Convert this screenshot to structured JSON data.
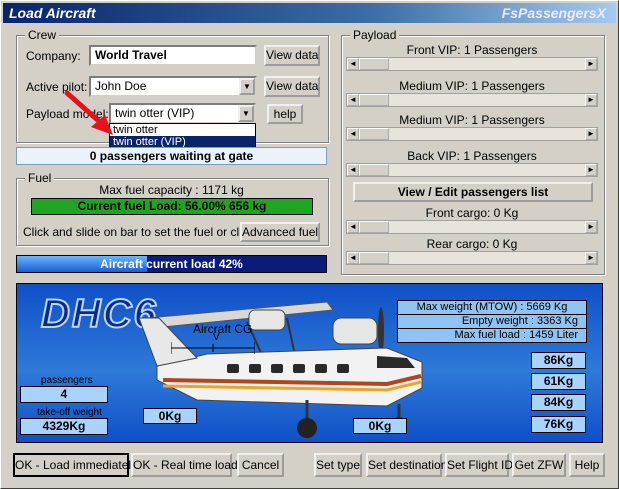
{
  "window": {
    "title": "Load Aircraft",
    "brand_prefix": "FsPassengers",
    "brand_suffix": "X"
  },
  "crew": {
    "group_label": "Crew",
    "company_label": "Company:",
    "company_value": "World Travel",
    "company_view_button": "View data",
    "pilot_label": "Active pilot:",
    "pilot_value": "John Doe",
    "pilot_view_button": "View data",
    "payload_model_label": "Payload model:",
    "payload_model_value": "twin otter (VIP)",
    "help_button": "help",
    "payload_model_options": [
      "twin otter",
      "twin otter (VIP)"
    ],
    "payload_model_selected_index": 1
  },
  "gate_status": "0 passengers waiting at gate",
  "fuel": {
    "group_label": "Fuel",
    "max_capacity": "Max fuel capacity : 1171 kg",
    "current_load": "Current fuel Load: 56.00%  656 kg",
    "current_percent": 56,
    "hint": "Click and slide on bar to set the fuel or click :",
    "advanced_button": "Advanced fuel"
  },
  "aircraft_load": {
    "text": "Aircraft current load 42%",
    "percent": 42
  },
  "payload": {
    "group_label": "Payload",
    "sections": [
      {
        "label": "Front VIP: 1 Passengers"
      },
      {
        "label": "Medium VIP: 1 Passengers"
      },
      {
        "label": "Medium VIP: 1 Passengers"
      },
      {
        "label": "Back VIP: 1 Passengers"
      }
    ],
    "view_list_button": "View / Edit passengers list",
    "front_cargo": "Front cargo: 0 Kg",
    "rear_cargo": "Rear cargo: 0 Kg"
  },
  "aircraft_panel": {
    "model": "DHC6",
    "cg_label": "Aircraft CG",
    "cg_marker": "V",
    "mtow": "Max weight (MTOW) : 5669 Kg",
    "empty_weight": "Empty weight : 3363 Kg",
    "max_fuel_load": "Max fuel load : 1459 Liter",
    "passengers_label": "passengers",
    "passengers_value": "4",
    "takeoff_label": "take-off weight",
    "takeoff_value": "4329Kg",
    "front_cargo_kg": "0Kg",
    "rear_cargo_kg": "0Kg",
    "section_weights": [
      "86Kg",
      "61Kg",
      "84Kg",
      "76Kg"
    ]
  },
  "buttons": {
    "load_immediately": "OK - Load immediately",
    "load_realtime": "OK - Real time load",
    "cancel": "Cancel",
    "set_type": "Set type",
    "set_destination": "Set destination",
    "set_flight_id": "Set Flight ID",
    "get_zfw": "Get ZFW",
    "help": "Help"
  },
  "colors": {
    "title_bar": "#0a246a",
    "fuel_bar": "#1fa51f",
    "load_bar": "#0c1a78",
    "panel_bg": "#1c62d0",
    "annotation_arrow": "#e8121c"
  }
}
